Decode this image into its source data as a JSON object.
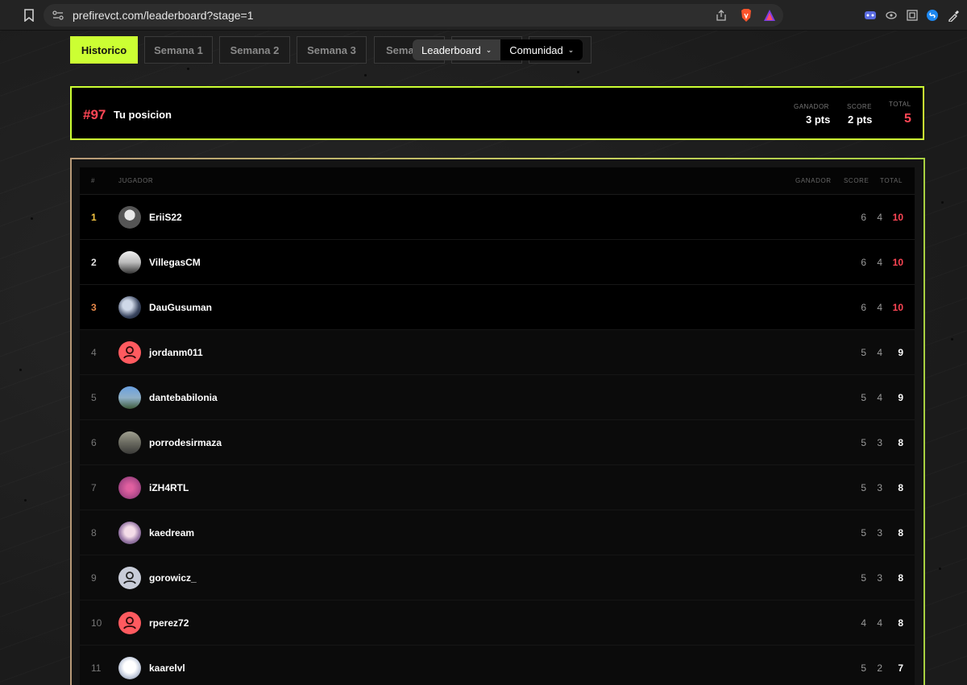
{
  "browser": {
    "url": "prefirevct.com/leaderboard?stage=1"
  },
  "tabs": [
    {
      "label": "Historico",
      "active": true
    },
    {
      "label": "Semana 1",
      "active": false
    },
    {
      "label": "Semana 2",
      "active": false
    },
    {
      "label": "Semana 3",
      "active": false
    },
    {
      "label": "Sema",
      "active": false
    }
  ],
  "nav_pills": {
    "leaderboard": "Leaderboard",
    "comunidad": "Comunidad"
  },
  "position": {
    "rank": "#97",
    "label": "Tu posicion",
    "ganador_head": "GANADOR",
    "ganador_val": "3 pts",
    "score_head": "SCORE",
    "score_val": "2 pts",
    "total_head": "TOTAL",
    "total_val": "5"
  },
  "table": {
    "headers": {
      "rank": "#",
      "player": "JUGADOR",
      "ganador": "GANADOR",
      "score": "SCORE",
      "total": "TOTAL"
    },
    "rows": [
      {
        "rank": "1",
        "name": "EriiS22",
        "ganador": "6",
        "score": "4",
        "total": "10",
        "avatar": "photo"
      },
      {
        "rank": "2",
        "name": "VillegasCM",
        "ganador": "6",
        "score": "4",
        "total": "10",
        "avatar": "photo"
      },
      {
        "rank": "3",
        "name": "DauGusuman",
        "ganador": "6",
        "score": "4",
        "total": "10",
        "avatar": "photo"
      },
      {
        "rank": "4",
        "name": "jordanm011",
        "ganador": "5",
        "score": "4",
        "total": "9",
        "avatar": "default-red"
      },
      {
        "rank": "5",
        "name": "dantebabilonia",
        "ganador": "5",
        "score": "4",
        "total": "9",
        "avatar": "photo"
      },
      {
        "rank": "6",
        "name": "porrodesirmaza",
        "ganador": "5",
        "score": "3",
        "total": "8",
        "avatar": "photo"
      },
      {
        "rank": "7",
        "name": "iZH4RTL",
        "ganador": "5",
        "score": "3",
        "total": "8",
        "avatar": "photo"
      },
      {
        "rank": "8",
        "name": "kaedream",
        "ganador": "5",
        "score": "3",
        "total": "8",
        "avatar": "photo"
      },
      {
        "rank": "9",
        "name": "gorowicz_",
        "ganador": "5",
        "score": "3",
        "total": "8",
        "avatar": "default-grey"
      },
      {
        "rank": "10",
        "name": "rperez72",
        "ganador": "4",
        "score": "4",
        "total": "8",
        "avatar": "default-red"
      },
      {
        "rank": "11",
        "name": "kaarelvl",
        "ganador": "5",
        "score": "2",
        "total": "7",
        "avatar": "photo"
      }
    ]
  },
  "colors": {
    "accent": "#ccff33",
    "red": "#ff4655",
    "gold": "#f5c542",
    "bronze": "#e8894a"
  }
}
